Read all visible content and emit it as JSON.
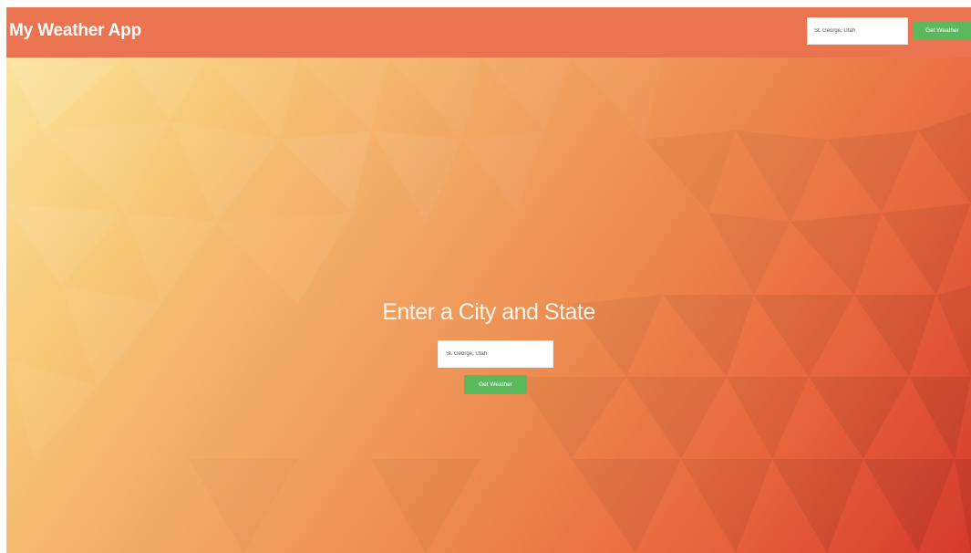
{
  "app": {
    "title": "My Weather App"
  },
  "navbar": {
    "search_value": "St. George, Utah",
    "button_label": "Get Weather",
    "background_color": "#ea7350"
  },
  "hero": {
    "heading": "Enter a City and State",
    "input_value": "St. George, Utah",
    "button_label": "Get Weather",
    "background": "low-poly gradient from pale yellow (top-left) to red (bottom-right)"
  },
  "colors": {
    "button_green": "#5cb85c",
    "gradient_start": "#fbe39c",
    "gradient_end": "#d43a2c",
    "text_white": "#ffffff"
  }
}
